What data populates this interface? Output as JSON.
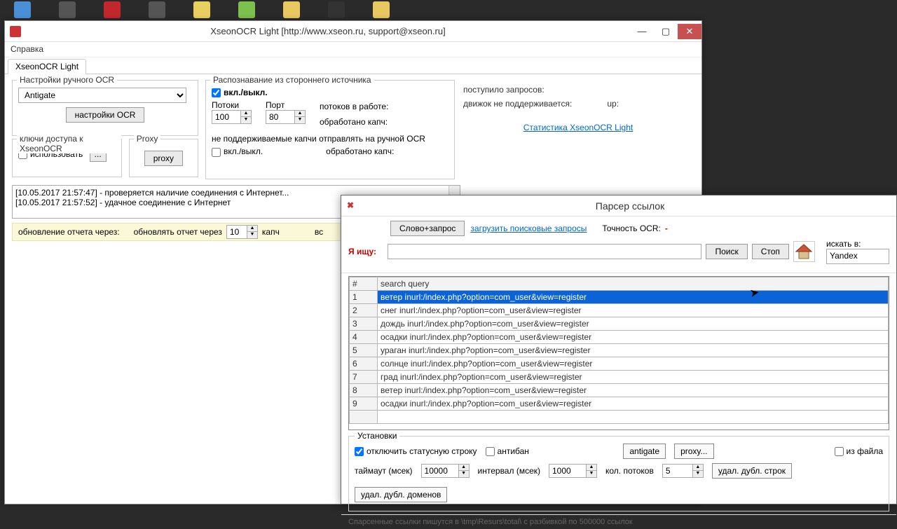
{
  "win1": {
    "title": "XseonOCR Light [http://www.xseon.ru, support@xseon.ru]",
    "menu_help": "Справка",
    "tab": "XseonOCR Light",
    "ocr_group": "Настройки ручного OCR",
    "service": "Antigate",
    "btn_ocr_settings": "настройки OCR",
    "keys_group": "ключи доступа к XseonOCR",
    "chk_use": "использовать",
    "btn_dots": "...",
    "proxy_group": "Proxy",
    "btn_proxy": "proxy",
    "recog_group": "Распознавание из стороннего источника",
    "chk_onoff": "вкл./выкл.",
    "threads_lbl": "Потоки",
    "threads_val": "100",
    "port_lbl": "Порт",
    "port_val": "80",
    "threads_work": "потоков в работе:",
    "captcha_done1": "обработано капч:",
    "unsupported": "не поддерживаемые капчи отправлять на ручной OCR",
    "chk_onoff2": "вкл./выкл.",
    "captcha_done2": "обработано капч:",
    "stats_req": "поступило запросов:",
    "stats_eng": "движок не поддерживается:",
    "stats_up": "up:",
    "stats_link": "Статистика XseonOCR Light",
    "log1": "[10.05.2017 21:57:47] - проверяется наличие соединения с Интернет...",
    "log2": "[10.05.2017 21:57:52] - удачное соединение с Интернет",
    "yb_update": "обновление отчета через:",
    "yb_refresh": "обновлять отчет через",
    "yb_val": "10",
    "yb_captch": "капч",
    "yb_vs": "вс"
  },
  "win2": {
    "title": "Парсер ссылок",
    "btn_word": "Слово+запрос",
    "link_load": "загрузить поисковые запросы",
    "ocr_acc": "Точность OCR:",
    "dash": "-",
    "search_lbl": "Я ищу:",
    "btn_search": "Поиск",
    "btn_stop": "Стоп",
    "search_in_lbl": "искать в:",
    "engine": "Yandex",
    "col_num": "#",
    "col_query": "search query",
    "rows": [
      {
        "n": "1",
        "q": "ветер inurl:/index.php?option=com_user&view=register"
      },
      {
        "n": "2",
        "q": "снег inurl:/index.php?option=com_user&view=register"
      },
      {
        "n": "3",
        "q": "дождь inurl:/index.php?option=com_user&view=register"
      },
      {
        "n": "4",
        "q": "осадки inurl:/index.php?option=com_user&view=register"
      },
      {
        "n": "5",
        "q": "ураган inurl:/index.php?option=com_user&view=register"
      },
      {
        "n": "6",
        "q": "солнце inurl:/index.php?option=com_user&view=register"
      },
      {
        "n": "7",
        "q": "град inurl:/index.php?option=com_user&view=register"
      },
      {
        "n": "8",
        "q": "ветер inurl:/index.php?option=com_user&view=register"
      },
      {
        "n": "9",
        "q": "осадки inurl:/index.php?option=com_user&view=register"
      }
    ],
    "sett_title": "Установки",
    "chk_status": "отключить статусную строку",
    "chk_antib": "антибан",
    "btn_antigate": "antigate",
    "btn_proxy": "proxy...",
    "chk_file": "из файла",
    "timeout_lbl": "таймаут (мсек)",
    "timeout_val": "10000",
    "interval_lbl": "интервал (мсек)",
    "interval_val": "1000",
    "threads_lbl": "кол. потоков",
    "threads_val": "5",
    "btn_dup_lines": "удал. дубл. строк",
    "btn_dup_dom": "удал. дубл. доменов",
    "footer": "Спарсенные ссылки пишутся в \\tmp\\Resurs\\total\\ с разбивкой по 500000 ссылок"
  }
}
